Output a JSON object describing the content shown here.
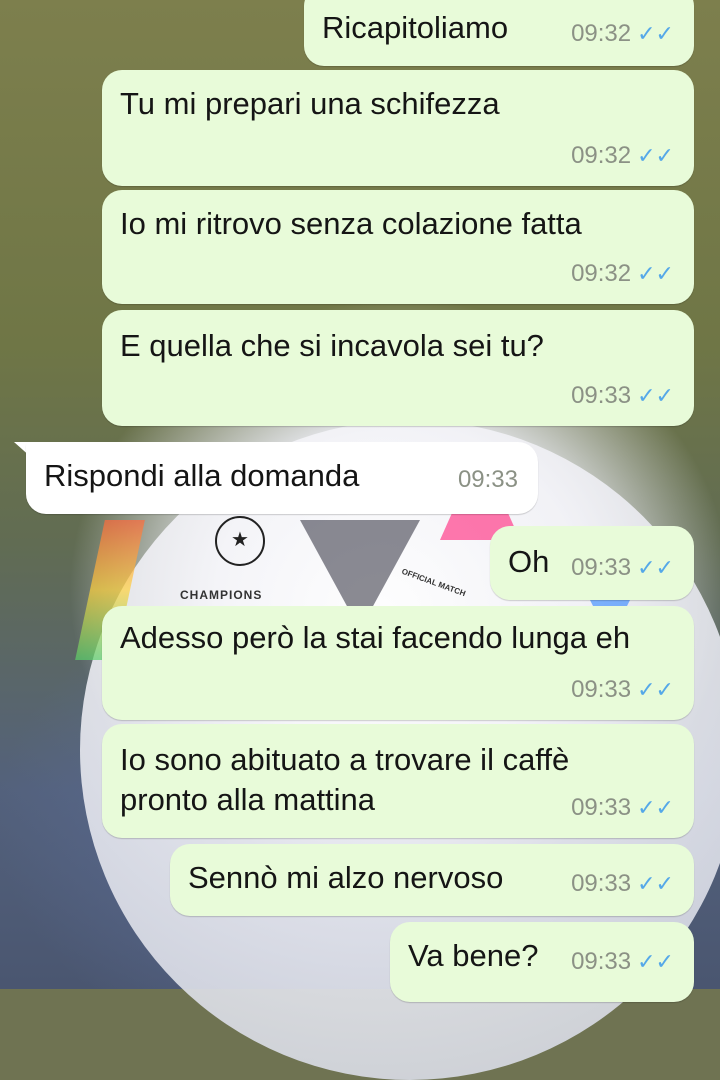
{
  "chat": {
    "messages": [
      {
        "direction": "out",
        "text": "Ricapitoliamo",
        "time": "09:32",
        "status": "read"
      },
      {
        "direction": "out",
        "text": "Tu mi prepari una schifezza",
        "time": "09:32",
        "status": "read"
      },
      {
        "direction": "out",
        "text": "Io mi ritrovo senza colazione fatta",
        "time": "09:32",
        "status": "read"
      },
      {
        "direction": "out",
        "text": "E quella che si incavola sei tu?",
        "time": "09:33",
        "status": "read"
      },
      {
        "direction": "in",
        "text": "Rispondi alla domanda",
        "time": "09:33"
      },
      {
        "direction": "out",
        "text": "Oh",
        "time": "09:33",
        "status": "read"
      },
      {
        "direction": "out",
        "text": "Adesso però la stai facendo lunga eh",
        "time": "09:33",
        "status": "read"
      },
      {
        "direction": "out",
        "text": "Io sono abituato a trovare il caffè pronto alla mattina",
        "time": "09:33",
        "status": "read"
      },
      {
        "direction": "out",
        "text": "Sennò mi alzo nervoso",
        "time": "09:33",
        "status": "read"
      },
      {
        "direction": "out",
        "text": "Va bene?",
        "time": "09:33",
        "status": "read"
      }
    ]
  },
  "wallpaper": {
    "logo_text": "CHAMPIONS",
    "ball_text": "OFFICIAL MATCH"
  },
  "icons": {
    "read_receipt": "double-check-icon"
  },
  "colors": {
    "outgoing_bubble": "#e8fbd9",
    "incoming_bubble": "#ffffff",
    "timestamp": "#8b9185",
    "read_tick": "#55a8e8"
  }
}
